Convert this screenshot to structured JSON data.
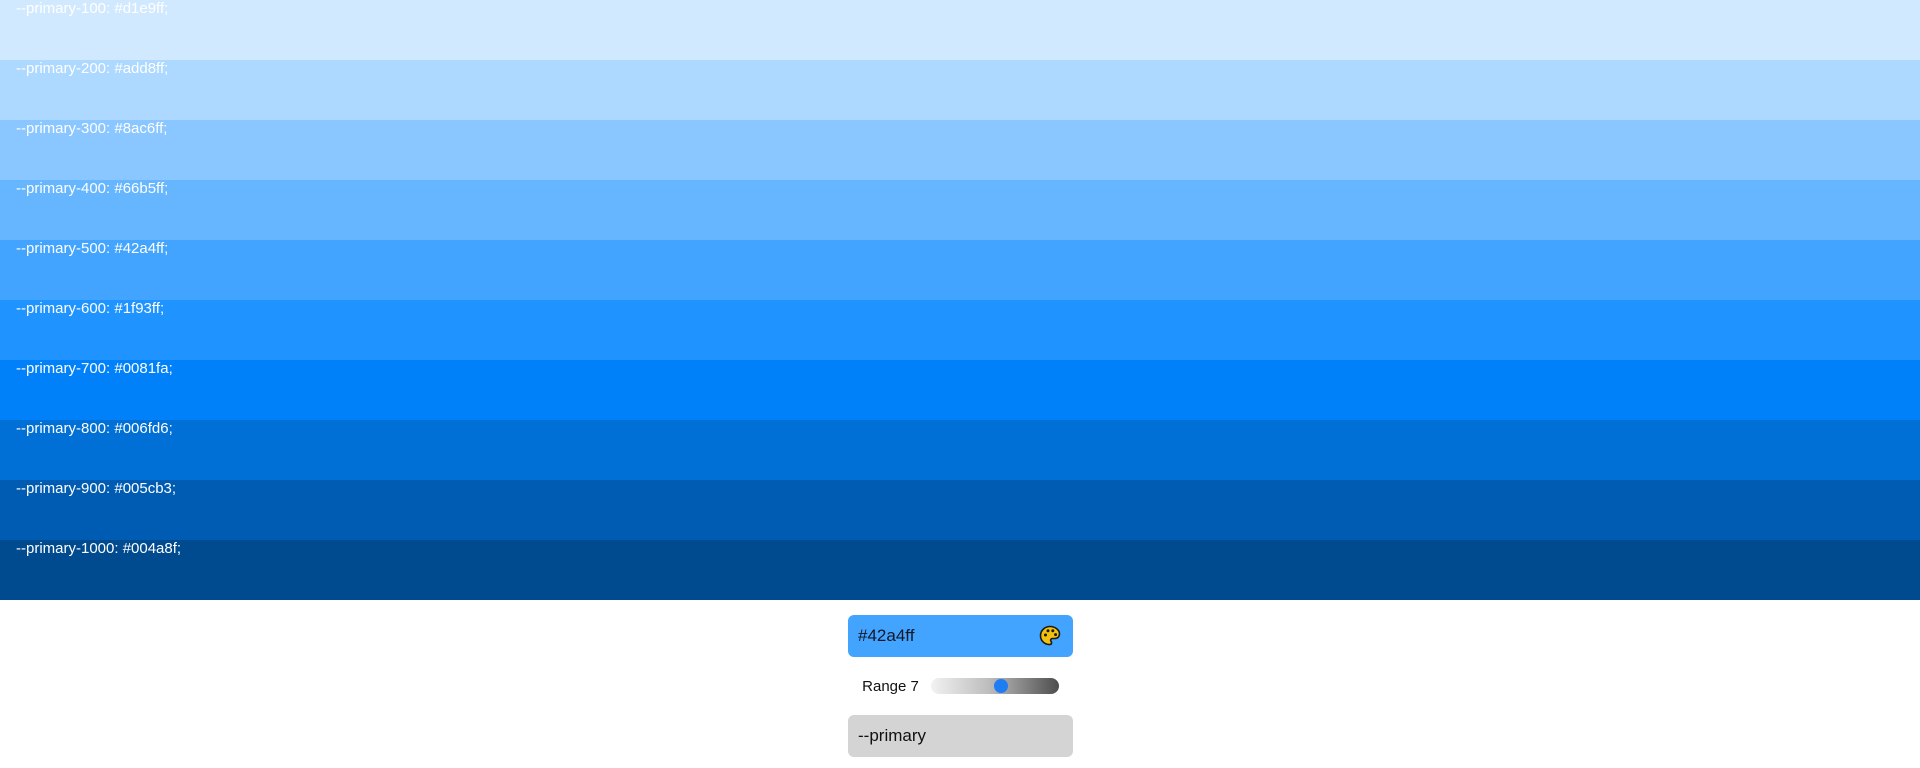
{
  "shades": [
    {
      "label": "--primary-100: #d1e9ff;",
      "color": "#d1e9ff"
    },
    {
      "label": "--primary-200: #add8ff;",
      "color": "#add8ff"
    },
    {
      "label": "--primary-300: #8ac6ff;",
      "color": "#8ac6ff"
    },
    {
      "label": "--primary-400: #66b5ff;",
      "color": "#66b5ff"
    },
    {
      "label": "--primary-500: #42a4ff;",
      "color": "#42a4ff"
    },
    {
      "label": "--primary-600: #1f93ff;",
      "color": "#1f93ff"
    },
    {
      "label": "--primary-700: #0081fa;",
      "color": "#0081fa"
    },
    {
      "label": "--primary-800: #006fd6;",
      "color": "#006fd6"
    },
    {
      "label": "--primary-900: #005cb3;",
      "color": "#005cb3"
    },
    {
      "label": "--primary-1000: #004a8f;",
      "color": "#004a8f"
    }
  ],
  "color_input": {
    "value": "#42a4ff",
    "icon": "palette-icon"
  },
  "range": {
    "label": "Range 7",
    "level": 0.55
  },
  "name_input": {
    "value": "--primary"
  }
}
